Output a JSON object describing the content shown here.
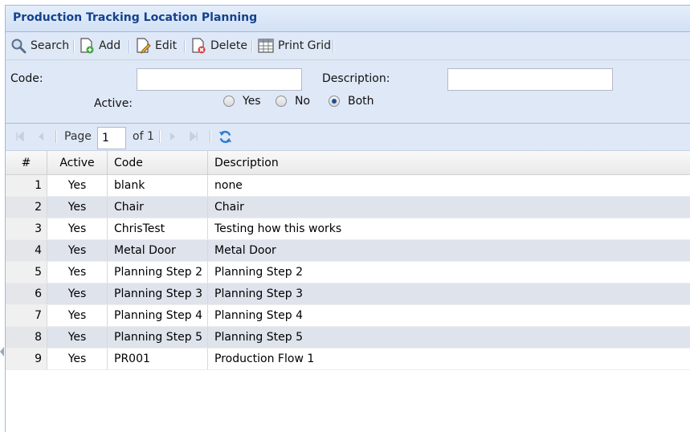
{
  "window": {
    "title": "Production Tracking Location Planning"
  },
  "toolbar": {
    "buttons": [
      {
        "label": "Search",
        "icon": "search-icon"
      },
      {
        "label": "Add",
        "icon": "add-document-icon"
      },
      {
        "label": "Edit",
        "icon": "edit-document-icon"
      },
      {
        "label": "Delete",
        "icon": "delete-document-icon"
      },
      {
        "label": "Print Grid",
        "icon": "grid-icon"
      }
    ]
  },
  "filter": {
    "code_label": "Code:",
    "code_value": "",
    "description_label": "Description:",
    "description_value": "",
    "active_label": "Active:",
    "options": [
      "Yes",
      "No",
      "Both"
    ],
    "selected": "Both"
  },
  "pager": {
    "page_label": "Page",
    "page_value": "1",
    "of_label": "of 1"
  },
  "grid": {
    "columns": [
      "#",
      "Active",
      "Code",
      "Description"
    ],
    "rows": [
      {
        "n": "1",
        "active": "Yes",
        "code": "blank",
        "description": "none"
      },
      {
        "n": "2",
        "active": "Yes",
        "code": "Chair",
        "description": "Chair"
      },
      {
        "n": "3",
        "active": "Yes",
        "code": "ChrisTest",
        "description": "Testing how this works"
      },
      {
        "n": "4",
        "active": "Yes",
        "code": "Metal Door",
        "description": "Metal Door"
      },
      {
        "n": "5",
        "active": "Yes",
        "code": "Planning Step 2",
        "description": "Planning Step 2"
      },
      {
        "n": "6",
        "active": "Yes",
        "code": "Planning Step 3",
        "description": "Planning Step 3"
      },
      {
        "n": "7",
        "active": "Yes",
        "code": "Planning Step 4",
        "description": "Planning Step 4"
      },
      {
        "n": "8",
        "active": "Yes",
        "code": "Planning Step 5",
        "description": "Planning Step 5"
      },
      {
        "n": "9",
        "active": "Yes",
        "code": "PR001",
        "description": "Production Flow 1"
      }
    ]
  },
  "colors": {
    "title": "#15428b",
    "panel": "#dfe8f6",
    "alt_row": "#dfe3ec",
    "border": "#99bbe8"
  }
}
